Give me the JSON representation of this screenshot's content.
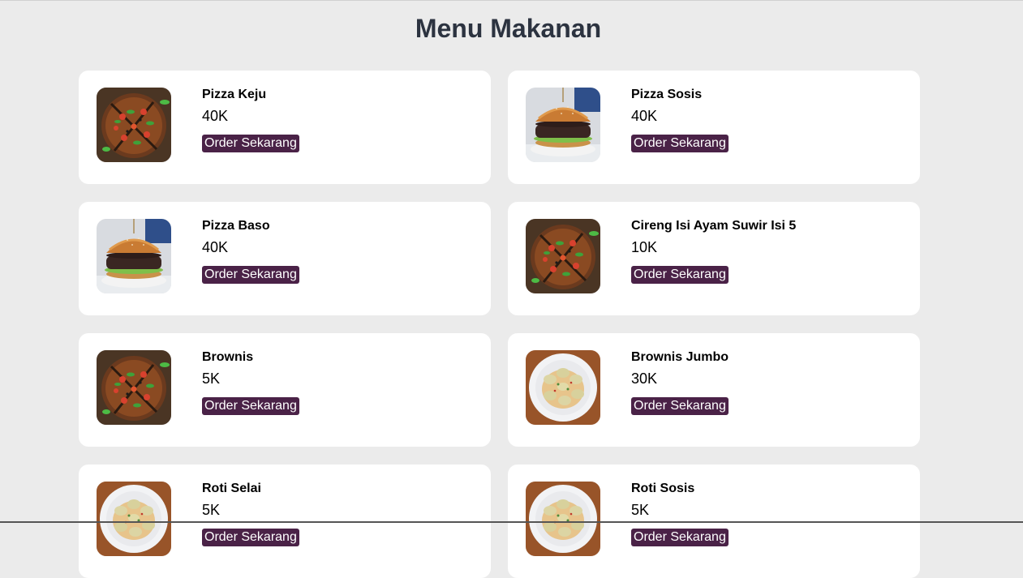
{
  "page": {
    "title": "Menu Makanan"
  },
  "colors": {
    "background": "#ebebeb",
    "card": "#ffffff",
    "button": "#4a2247",
    "title": "#2c3340"
  },
  "menu": {
    "items": [
      {
        "name": "Pizza Keju",
        "price": "40K",
        "button": "Order Sekarang",
        "image": "pizza"
      },
      {
        "name": "Pizza Sosis",
        "price": "40K",
        "button": "Order Sekarang",
        "image": "burger"
      },
      {
        "name": "Pizza Baso",
        "price": "40K",
        "button": "Order Sekarang",
        "image": "burger"
      },
      {
        "name": "Cireng Isi Ayam Suwir Isi 5",
        "price": "10K",
        "button": "Order Sekarang",
        "image": "pizza"
      },
      {
        "name": "Brownis",
        "price": "5K",
        "button": "Order Sekarang",
        "image": "pizza"
      },
      {
        "name": "Brownis Jumbo",
        "price": "30K",
        "button": "Order Sekarang",
        "image": "dumplings"
      },
      {
        "name": "Roti Selai",
        "price": "5K",
        "button": "Order Sekarang",
        "image": "dumplings"
      },
      {
        "name": "Roti Sosis",
        "price": "5K",
        "button": "Order Sekarang",
        "image": "dumplings"
      }
    ]
  }
}
